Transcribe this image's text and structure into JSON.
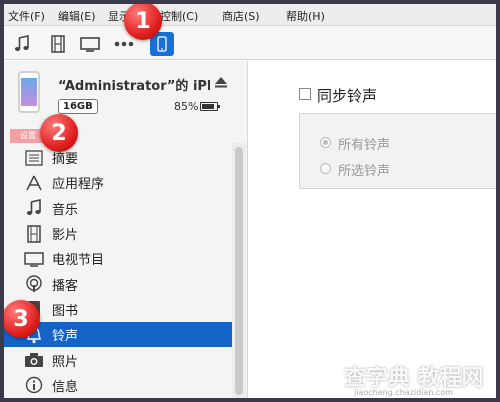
{
  "menu": {
    "items": [
      "文件(F)",
      "编辑(E)",
      "显示",
      "控制(C)",
      "商店(S)",
      "帮助(H)"
    ]
  },
  "toolbar": {
    "buttons": [
      {
        "name": "music-icon",
        "active": false
      },
      {
        "name": "film-icon",
        "active": false
      },
      {
        "name": "tv-icon",
        "active": false
      },
      {
        "name": "more-icon",
        "active": false
      },
      {
        "name": "iphone-icon",
        "active": true
      }
    ]
  },
  "device": {
    "name": "“Administrator”的 iPho...",
    "capacity": "16GB",
    "battery_pct": "85%",
    "battery_level": 0.85
  },
  "sidebar": {
    "header": "设置",
    "items": [
      {
        "label": "摘要",
        "icon": "summary-icon"
      },
      {
        "label": "应用程序",
        "icon": "apps-icon"
      },
      {
        "label": "音乐",
        "icon": "music-icon"
      },
      {
        "label": "影片",
        "icon": "film-icon"
      },
      {
        "label": "电视节目",
        "icon": "tv-icon"
      },
      {
        "label": "播客",
        "icon": "podcast-icon"
      },
      {
        "label": "图书",
        "icon": "book-icon"
      },
      {
        "label": "铃声",
        "icon": "bell-icon",
        "selected": true
      },
      {
        "label": "照片",
        "icon": "camera-icon"
      },
      {
        "label": "信息",
        "icon": "info-icon"
      }
    ]
  },
  "main": {
    "sync_label": "同步铃声",
    "options": [
      "所有铃声",
      "所选铃声"
    ]
  },
  "annotations": [
    "1",
    "2",
    "3"
  ],
  "watermark": {
    "text": "查字典 教程网",
    "url": "jiaocheng.chazidian.com"
  },
  "colors": {
    "selection": "#1464c8",
    "accent": "#1a6fd6",
    "badge": "#e02020"
  }
}
